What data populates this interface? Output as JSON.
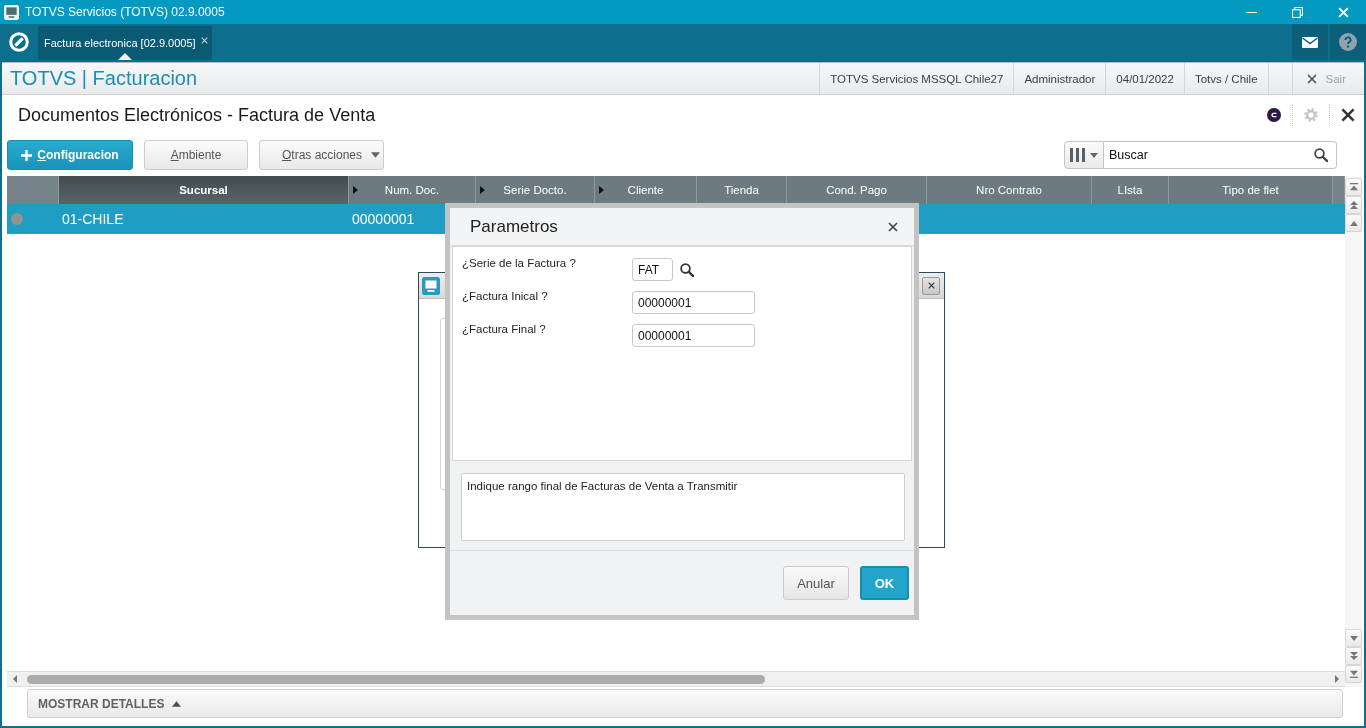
{
  "window": {
    "title": "TOTVS Servicios (TOTVS) 02.9.0005"
  },
  "tabs": [
    {
      "label": "Factura electronica [02.9.0005]",
      "selected": true
    }
  ],
  "header": {
    "brand": "TOTVS | Facturacion",
    "info": [
      "TOTVS Servicios MSSQL Chile27",
      "Administrador",
      "04/01/2022",
      "Totvs / Chile"
    ],
    "exit": "Sair"
  },
  "page": {
    "title": "Documentos Electrónicos - Factura de Venta"
  },
  "toolbar": {
    "buttons": [
      {
        "label": "Configuracion",
        "kind": "primary"
      },
      {
        "label": "Ambiente",
        "kind": "plain"
      },
      {
        "label": "Otras acciones",
        "kind": "menu"
      }
    ]
  },
  "search": {
    "placeholder": "Buscar"
  },
  "table": {
    "columns": [
      {
        "label": "Sucursal",
        "sorted": true,
        "indicator": false
      },
      {
        "label": "Num. Doc.",
        "sorted": false,
        "indicator": true
      },
      {
        "label": "Serie Docto.",
        "sorted": false,
        "indicator": true
      },
      {
        "label": "Cliente",
        "sorted": false,
        "indicator": true
      },
      {
        "label": "Tienda",
        "sorted": false,
        "indicator": false
      },
      {
        "label": "Cond. Pago",
        "sorted": false,
        "indicator": false
      },
      {
        "label": "Nro Contrato",
        "sorted": false,
        "indicator": false
      },
      {
        "label": "LIsta",
        "sorted": false,
        "indicator": false
      },
      {
        "label": "Tipo de flet",
        "sorted": false,
        "indicator": false
      }
    ],
    "rows": [
      {
        "selected": true,
        "color": "#939393",
        "cells": [
          "01-CHILE",
          "00000001"
        ]
      }
    ]
  },
  "dialog": {
    "title": "Parametros",
    "fields": [
      {
        "label": "¿Serie de la Factura ?",
        "value": "FAT",
        "kind": "lookup"
      },
      {
        "label": "¿Factura Inical ?",
        "value": "00000001",
        "kind": "text"
      },
      {
        "label": "¿Factura Final ?",
        "value": "00000001",
        "kind": "text"
      }
    ],
    "help": "Indique rango final de Facturas de Venta a Transmitir",
    "buttons": [
      {
        "label": "Anular",
        "kind": "plain"
      },
      {
        "label": "OK",
        "kind": "primary"
      }
    ]
  },
  "details": {
    "label": "MOSTRAR DETALLES",
    "expanded": false
  }
}
